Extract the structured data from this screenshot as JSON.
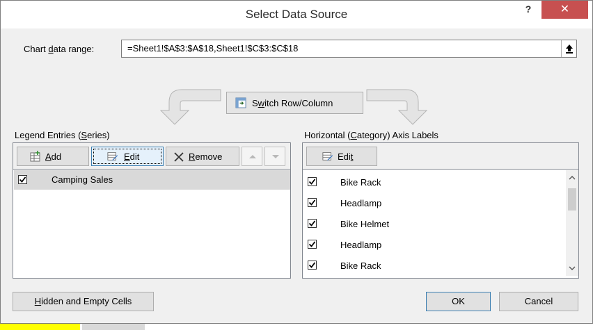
{
  "window": {
    "title": "Select Data Source",
    "help_glyph": "?",
    "close_glyph": "✕"
  },
  "chart_range": {
    "label_pre": "Chart ",
    "label_u": "d",
    "label_post": "ata range:",
    "value": "=Sheet1!$A$3:$A$18,Sheet1!$C$3:$C$18"
  },
  "switch_button": {
    "pre": "S",
    "u": "w",
    "post": "itch Row/Column"
  },
  "legend": {
    "heading_pre": "Legend Entries (",
    "heading_u": "S",
    "heading_post": "eries)",
    "add_pre": "",
    "add_u": "A",
    "add_post": "dd",
    "edit_pre": "",
    "edit_u": "E",
    "edit_post": "dit",
    "remove_pre": "",
    "remove_u": "R",
    "remove_post": "emove",
    "series": [
      {
        "label": "Camping Sales",
        "checked": true
      }
    ]
  },
  "axis": {
    "heading_pre": "Horizontal (",
    "heading_u": "C",
    "heading_post": "ategory) Axis Labels",
    "edit_pre": "Edi",
    "edit_u": "t",
    "edit_post": "",
    "items": [
      {
        "label": "Bike Rack",
        "checked": true
      },
      {
        "label": "Headlamp",
        "checked": true
      },
      {
        "label": "Bike Helmet",
        "checked": true
      },
      {
        "label": "Headlamp",
        "checked": true
      },
      {
        "label": "Bike Rack",
        "checked": true
      }
    ]
  },
  "footer": {
    "hidden_pre": "",
    "hidden_u": "H",
    "hidden_post": "idden and Empty Cells",
    "ok": "OK",
    "cancel": "Cancel"
  },
  "colors": {
    "close_bg": "#c75050",
    "focus_border": "#3c7fb1",
    "selection_bg": "#d9d9d9"
  }
}
